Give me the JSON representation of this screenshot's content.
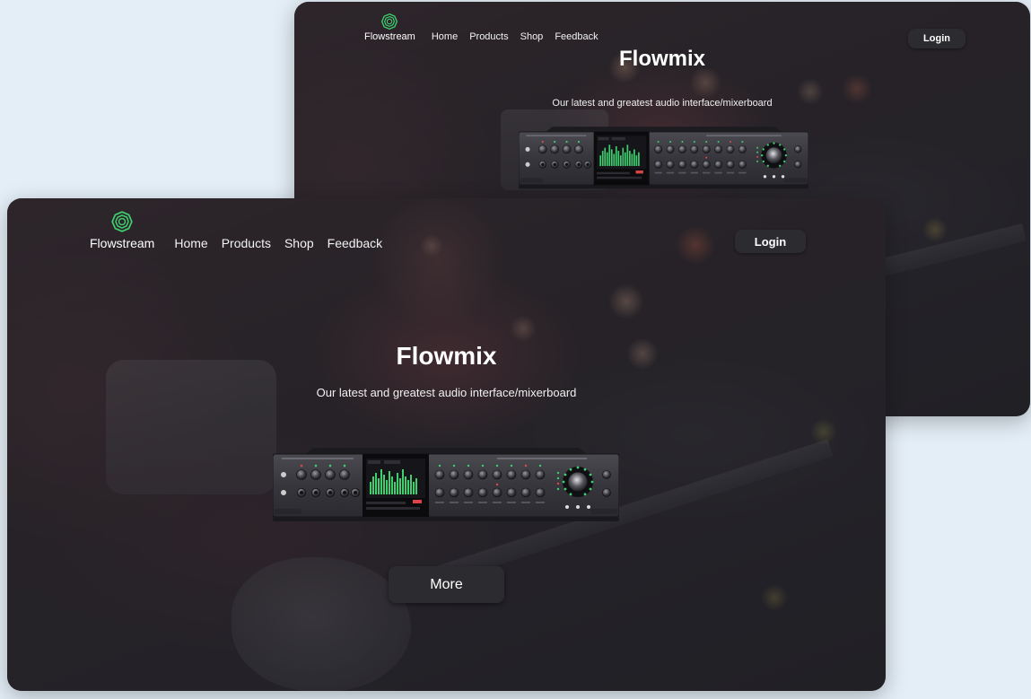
{
  "brand": {
    "name": "Flowstream"
  },
  "nav": {
    "links": [
      "Home",
      "Products",
      "Shop",
      "Feedback"
    ],
    "login_label": "Login"
  },
  "hero": {
    "title": "Flowmix",
    "subtitle": "Our latest and greatest audio interface/mixerboard",
    "more_label": "More"
  },
  "colors": {
    "page_background": "#e4eef7",
    "button_background": "#2c2b30",
    "logo_accent": "#3ecf6f"
  },
  "icons": {
    "logo": "swirl-logo-icon"
  }
}
